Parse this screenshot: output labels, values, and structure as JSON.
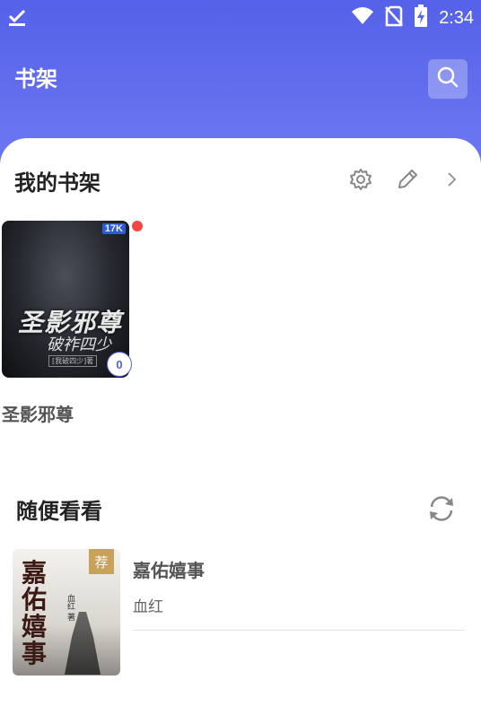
{
  "status_bar": {
    "time": "2:34",
    "icons": [
      "download-done-icon",
      "wifi-icon",
      "no-sim-icon",
      "battery-charging-icon"
    ]
  },
  "header": {
    "title": "书架",
    "search_icon": "search-icon",
    "gradient_colors": [
      "#5561e8",
      "#6e7af2"
    ]
  },
  "bookshelf": {
    "title": "我的书架",
    "actions": [
      "gear-icon",
      "pencil-icon",
      "chevron-right-icon"
    ],
    "books": [
      {
        "name": "圣影邪尊",
        "cover_logo": "17K",
        "cover_title": "圣影邪尊",
        "cover_subtitle": "破祚四少",
        "cover_author": "[我破四少]著",
        "update_count": "0",
        "has_unread_dot": true
      }
    ]
  },
  "browse": {
    "title": "随便看看",
    "refresh_icon": "refresh-icon",
    "items": [
      {
        "title": "嘉佑嬉事",
        "author": "血红",
        "tag": "荐",
        "cover_title": "嘉佑嬉事",
        "cover_author": "血红 著"
      }
    ]
  },
  "colors": {
    "accent": "#5561e8",
    "unread_dot": "#f04646",
    "tag": "#c9a25a"
  }
}
